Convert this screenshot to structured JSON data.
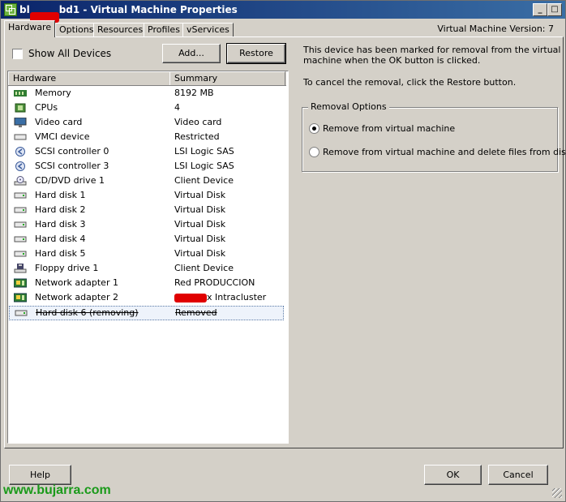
{
  "window": {
    "title": "bl      bd1 - Virtual Machine Properties",
    "title_prefix": "bl",
    "title_suffix": "bd1 - Virtual Machine Properties",
    "accent": "#0a246a"
  },
  "tabs": [
    {
      "label": "Hardware",
      "active": true
    },
    {
      "label": "Options"
    },
    {
      "label": "Resources"
    },
    {
      "label": "Profiles"
    },
    {
      "label": "vServices"
    }
  ],
  "vm_version": "Virtual Machine Version: 7",
  "show_all_devices": {
    "label": "Show All Devices",
    "checked": false
  },
  "buttons": {
    "add": "Add...",
    "restore": "Restore",
    "help": "Help",
    "ok": "OK",
    "cancel": "Cancel"
  },
  "table": {
    "headers": [
      "Hardware",
      "Summary"
    ],
    "rows": [
      {
        "icon": "memory-icon",
        "name": "Memory",
        "summary": "8192 MB"
      },
      {
        "icon": "cpu-icon",
        "name": "CPUs",
        "summary": "4"
      },
      {
        "icon": "monitor-icon",
        "name": "Video card",
        "summary": "Video card"
      },
      {
        "icon": "vmci-device-icon",
        "name": "VMCI device",
        "summary": "Restricted"
      },
      {
        "icon": "scsi-controller-icon",
        "name": "SCSI controller 0",
        "summary": "LSI Logic SAS"
      },
      {
        "icon": "scsi-controller-icon",
        "name": "SCSI controller 3",
        "summary": "LSI Logic SAS"
      },
      {
        "icon": "cd-dvd-drive-icon",
        "name": "CD/DVD drive 1",
        "summary": "Client Device"
      },
      {
        "icon": "hard-disk-icon",
        "name": "Hard disk 1",
        "summary": "Virtual Disk"
      },
      {
        "icon": "hard-disk-icon",
        "name": "Hard disk 2",
        "summary": "Virtual Disk"
      },
      {
        "icon": "hard-disk-icon",
        "name": "Hard disk 3",
        "summary": "Virtual Disk"
      },
      {
        "icon": "hard-disk-icon",
        "name": "Hard disk 4",
        "summary": "Virtual Disk"
      },
      {
        "icon": "hard-disk-icon",
        "name": "Hard disk 5",
        "summary": "Virtual Disk"
      },
      {
        "icon": "floppy-drive-icon",
        "name": "Floppy drive 1",
        "summary": "Client Device"
      },
      {
        "icon": "network-adapter-icon",
        "name": "Network adapter 1",
        "summary": "Red PRODUCCION"
      },
      {
        "icon": "network-adapter-icon",
        "name": "Network adapter 2",
        "summary": "x Intracluster"
      },
      {
        "icon": "hard-disk-icon",
        "name": "Hard disk 6 (removing)",
        "summary": "Removed",
        "selected": true
      }
    ]
  },
  "info": {
    "line1": "This device has been marked for removal from the virtual",
    "line2": "machine when the OK button is clicked.",
    "line3": "To cancel the removal, click the Restore button."
  },
  "removal_options": {
    "title": "Removal Options",
    "options": [
      {
        "label": "Remove from virtual machine",
        "selected": true
      },
      {
        "label": "Remove from virtual machine and delete files from disk",
        "selected": false
      }
    ]
  },
  "watermark": "www.bujarra.com",
  "colors": {
    "redaction": "#e00000",
    "watermark": "#1a9a1a",
    "dialog_bg": "#d4d0c8"
  }
}
